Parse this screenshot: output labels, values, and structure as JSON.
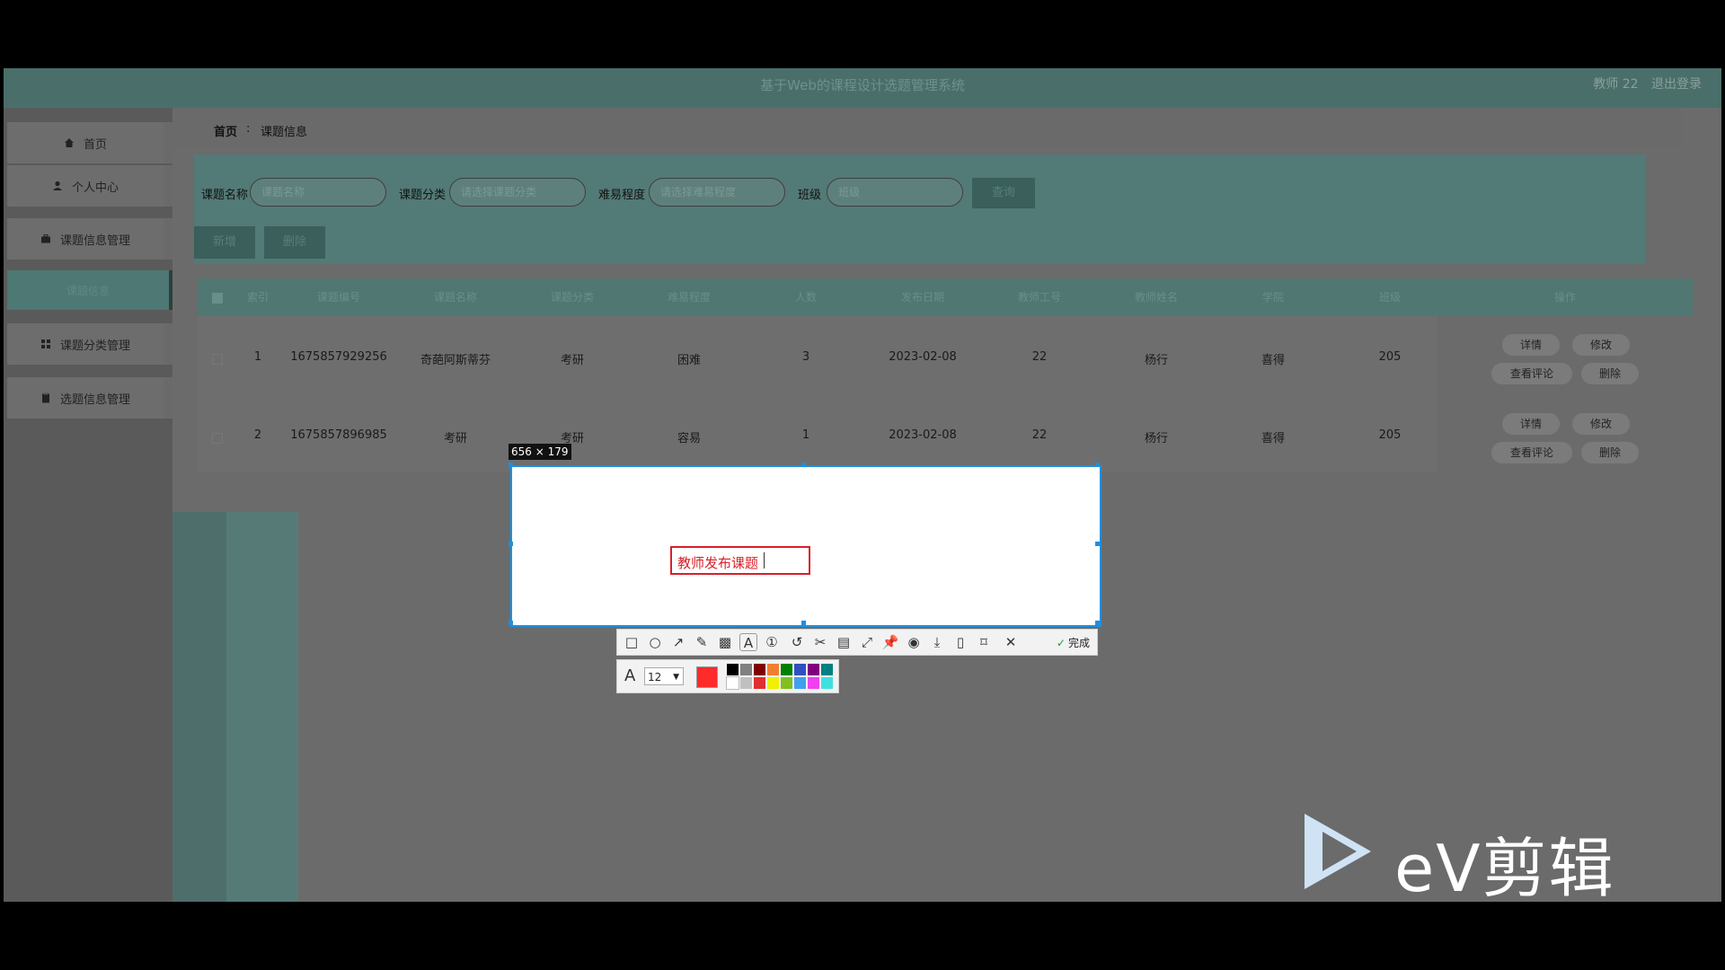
{
  "app": {
    "title": "基于Web的课程设计选题管理系统",
    "user_label": "教师 22",
    "logout": "退出登录"
  },
  "sidebar": {
    "items": [
      {
        "label": "首页",
        "icon": "home-icon"
      },
      {
        "label": "个人中心",
        "icon": "user-icon"
      },
      {
        "label": "课题信息管理",
        "icon": "briefcase-icon"
      },
      {
        "label": "课题信息",
        "icon": ""
      },
      {
        "label": "课题分类管理",
        "icon": "grid-icon"
      },
      {
        "label": "选题信息管理",
        "icon": "clipboard-icon"
      }
    ]
  },
  "breadcrumb": {
    "home": "首页",
    "sep": ":",
    "current": "课题信息"
  },
  "search": {
    "name_label": "课题名称",
    "name_placeholder": "课题名称",
    "category_label": "课题分类",
    "category_placeholder": "请选择课题分类",
    "difficulty_label": "难易程度",
    "difficulty_placeholder": "请选择难易程度",
    "class_label": "班级",
    "class_placeholder": "班级",
    "query_button": "查询"
  },
  "actions": {
    "add": "新增",
    "delete": "删除"
  },
  "table": {
    "headers": [
      "索引",
      "课题编号",
      "课题名称",
      "课题分类",
      "难易程度",
      "人数",
      "发布日期",
      "教师工号",
      "教师姓名",
      "学院",
      "班级",
      "操作"
    ],
    "rows": [
      [
        "1",
        "1675857929256",
        "奇葩阿斯蒂芬",
        "考研",
        "困难",
        "3",
        "2023-02-08",
        "22",
        "杨行",
        "喜得",
        "205"
      ],
      [
        "2",
        "1675857896985",
        "考研",
        "考研",
        "容易",
        "1",
        "2023-02-08",
        "22",
        "杨行",
        "喜得",
        "205"
      ]
    ],
    "row_buttons": {
      "detail": "详情",
      "edit": "修改",
      "comments": "查看评论",
      "delete": "删除"
    }
  },
  "capture": {
    "size_label": "656 × 179",
    "text": "教师发布课题",
    "done": "完成",
    "font_size": "12",
    "current_color": "#ff2a2a",
    "tools": [
      "rect-icon",
      "ellipse-icon",
      "arrow-icon",
      "pencil-icon",
      "mosaic-icon",
      "text-icon",
      "number-icon",
      "undo-icon",
      "cut-icon",
      "ocr-icon",
      "expand-icon",
      "pin-icon",
      "record-icon",
      "download-icon",
      "save-icon",
      "bookmark-icon",
      "close-icon",
      "check-icon"
    ],
    "palette": [
      "#000000",
      "#808080",
      "#800000",
      "#f08030",
      "#008000",
      "#3050c0",
      "#800080",
      "#008080",
      "#ffffff",
      "#c0c0c0",
      "#e03030",
      "#f0f000",
      "#80c020",
      "#40a0f0",
      "#f040f0",
      "#40e0e0"
    ]
  },
  "watermark": {
    "text": "eV剪辑"
  }
}
